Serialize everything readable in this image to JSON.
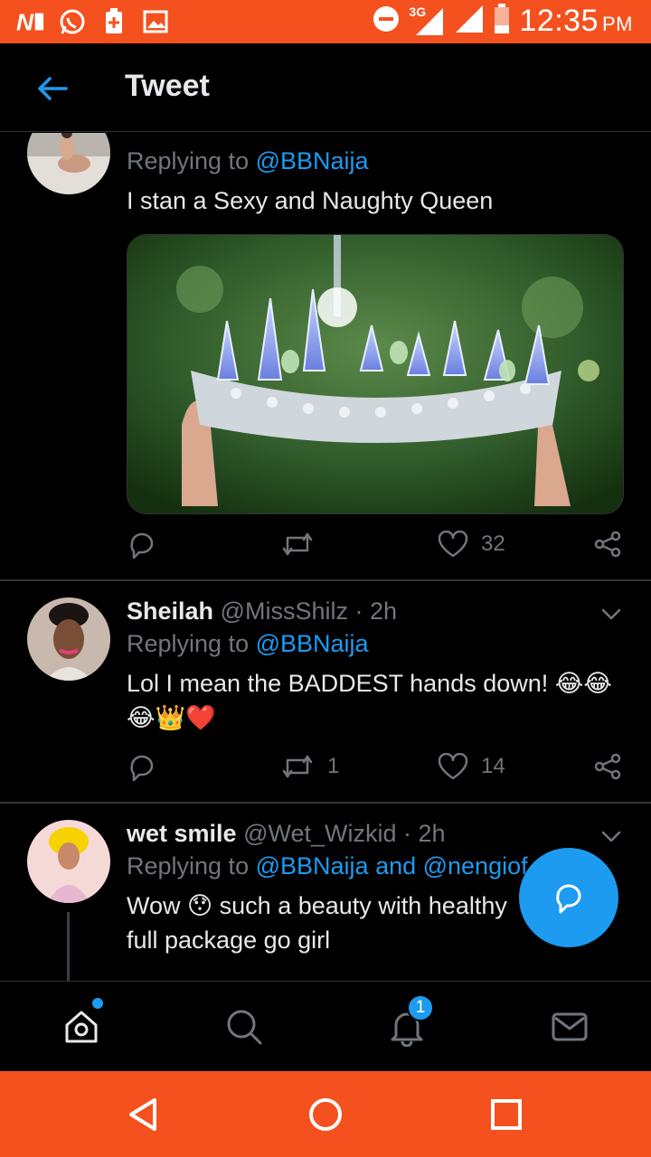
{
  "status_bar": {
    "time": "12:35",
    "ampm": "PM",
    "network": "3G",
    "background": "#f4511e"
  },
  "header": {
    "title": "Tweet"
  },
  "tweets": [
    {
      "reply_prefix": "Replying to",
      "mention": "@BBNaija",
      "text": "I stan a Sexy and Naughty Queen",
      "likes": "32",
      "retweets": ""
    },
    {
      "name": "Sheilah",
      "handle": "@MissShilz",
      "time": "· 2h",
      "reply_prefix": "Replying to",
      "mention": "@BBNaija",
      "text_line1": "Lol I mean the BADDEST hands down! 😂😂",
      "text_line2": "😂👑❤️",
      "retweets": "1",
      "likes": "14"
    },
    {
      "name": "wet smile",
      "handle": "@Wet_Wizkid",
      "time": "· 2h",
      "reply_prefix": "Replying to",
      "mention": "@BBNaija and @nengiof",
      "text_line1": "Wow 😯 such a beauty with healthy",
      "text_line2": "full package go girl"
    }
  ],
  "tabbar": {
    "notifications_badge": "1"
  },
  "colors": {
    "accent": "#1d9bf0",
    "muted": "#71767b",
    "android_bar": "#f4511e"
  }
}
